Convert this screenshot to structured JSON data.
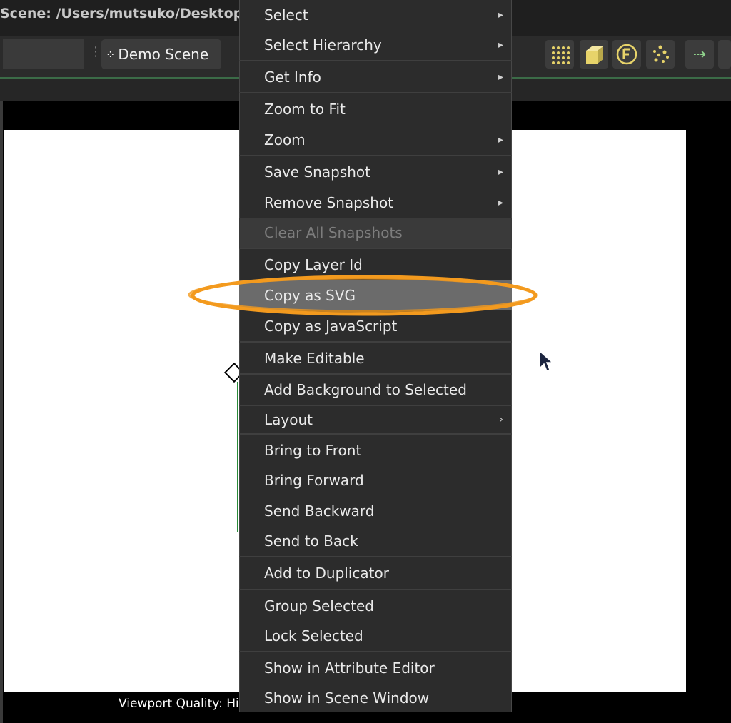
{
  "window": {
    "title": "Scene: /Users/mutsuko/Desktop/"
  },
  "toolbar": {
    "scene_button_label": "Demo Scene",
    "icons": [
      "grid-dots-icon",
      "cube-icon",
      "f-badge-icon",
      "scatter-icon",
      "arrow-right-icon"
    ]
  },
  "viewport": {
    "quality_label": "Viewport Quality: Hi"
  },
  "context_menu": {
    "items": [
      {
        "label": "Select",
        "submenu": "▸"
      },
      {
        "label": "Select Hierarchy",
        "submenu": "▸"
      },
      {
        "label": "Get Info",
        "submenu": "▸"
      },
      {
        "label": "Zoom to Fit"
      },
      {
        "label": "Zoom",
        "submenu": "▸"
      },
      {
        "label": "Save Snapshot",
        "submenu": "▸"
      },
      {
        "label": "Remove Snapshot",
        "submenu": "▸"
      },
      {
        "label": "Clear All Snapshots",
        "disabled": true
      },
      {
        "label": "Copy Layer Id"
      },
      {
        "label": "Copy as SVG",
        "highlighted": true
      },
      {
        "label": "Copy as JavaScript"
      },
      {
        "label": "Make Editable"
      },
      {
        "label": "Add Background to Selected"
      },
      {
        "label": "Layout",
        "submenu": "›"
      },
      {
        "label": "Bring to Front"
      },
      {
        "label": "Bring Forward"
      },
      {
        "label": "Send Backward"
      },
      {
        "label": "Send to Back"
      },
      {
        "label": "Add to Duplicator"
      },
      {
        "label": "Group Selected"
      },
      {
        "label": "Lock Selected"
      },
      {
        "label": "Show in Attribute Editor"
      },
      {
        "label": "Show in Scene Window"
      }
    ]
  },
  "colors": {
    "annotation": "#f39a1e",
    "menu_bg": "#2c2c2c",
    "highlight": "#6b6b6b",
    "accent_green": "#3b6b47"
  }
}
